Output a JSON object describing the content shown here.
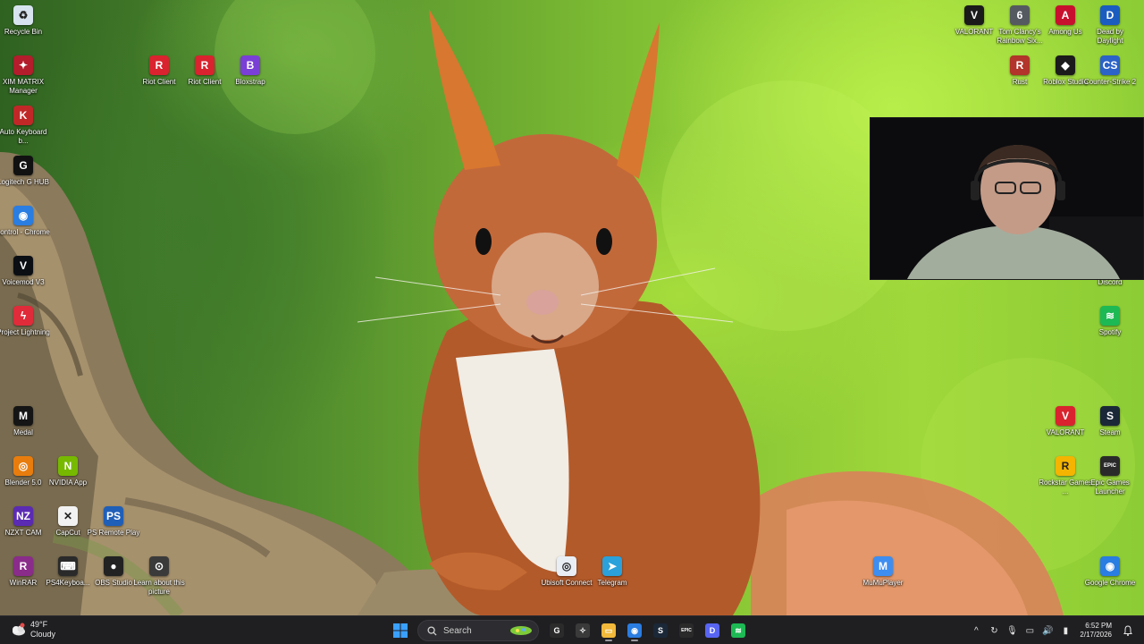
{
  "desktop": {
    "left_icons": [
      {
        "label": "Recycle Bin",
        "icon": "recycle-bin-icon",
        "color": "#d7e4ef",
        "glyph": "♻"
      },
      {
        "label": "XIM MATRIX Manager",
        "icon": "xim-matrix-icon",
        "color": "#b31d2c",
        "glyph": "✦"
      },
      {
        "label": "Auto Keyboard b...",
        "icon": "auto-keyboard-icon",
        "color": "#c02828",
        "glyph": "K"
      },
      {
        "label": "Logitech G HUB",
        "icon": "logitech-ghub-icon",
        "color": "#111111",
        "glyph": "G"
      },
      {
        "label": "control - Chrome",
        "icon": "chrome-icon",
        "color": "#2a7de1",
        "glyph": "◉"
      },
      {
        "label": "Voicemod V3",
        "icon": "voicemod-icon",
        "color": "#0b0f14",
        "glyph": "V"
      },
      {
        "label": "Project Lightning",
        "icon": "project-lightning-icon",
        "color": "#e02b3a",
        "glyph": "ϟ"
      },
      {
        "label": "Medal",
        "icon": "medal-icon",
        "color": "#151515",
        "glyph": "M"
      },
      {
        "label": "Blender 5.0",
        "icon": "blender-icon",
        "color": "#e87d0d",
        "glyph": "◎"
      },
      {
        "label": "NVIDIA App",
        "icon": "nvidia-icon",
        "color": "#76b900",
        "glyph": "N"
      },
      {
        "label": "NZXT CAM",
        "icon": "nzxt-cam-icon",
        "color": "#5b2bb3",
        "glyph": "NZ"
      },
      {
        "label": "CapCut",
        "icon": "capcut-icon",
        "color": "#f2f2f2",
        "glyph": "✕"
      },
      {
        "label": "PS Remote Play",
        "icon": "ps-remote-play-icon",
        "color": "#1f5fb8",
        "glyph": "PS"
      },
      {
        "label": "WinRAR",
        "icon": "winrar-icon",
        "color": "#8a2c8a",
        "glyph": "R"
      },
      {
        "label": "PS4Keyboa...",
        "icon": "ps4-keyboard-icon",
        "color": "#2a2a2a",
        "glyph": "⌨"
      },
      {
        "label": "OBS Studio",
        "icon": "obs-studio-icon",
        "color": "#222222",
        "glyph": "●"
      },
      {
        "label": "Learn about this picture",
        "icon": "learn-picture-icon",
        "color": "#3a3a3a",
        "glyph": "⊙"
      },
      {
        "label": "Riot Client",
        "icon": "riot-client-icon",
        "color": "#d9232e",
        "glyph": "R"
      },
      {
        "label": "Riot Client",
        "icon": "riot-client-icon",
        "color": "#d9232e",
        "glyph": "R"
      },
      {
        "label": "Bloxstrap",
        "icon": "bloxstrap-icon",
        "color": "#7a3fd6",
        "glyph": "B"
      }
    ],
    "right_icons": [
      {
        "label": "VALORANT",
        "icon": "valorant-icon",
        "color": "#1a1a1a",
        "glyph": "V"
      },
      {
        "label": "Tom Clancy's Rainbow Six...",
        "icon": "rainbow-six-icon",
        "color": "#555a60",
        "glyph": "6"
      },
      {
        "label": "Among Us",
        "icon": "among-us-icon",
        "color": "#c8102e",
        "glyph": "A"
      },
      {
        "label": "Dead by Daylight",
        "icon": "dead-by-daylight-icon",
        "color": "#1b5cc0",
        "glyph": "D"
      },
      {
        "label": "Rust",
        "icon": "rust-icon",
        "color": "#b2342a",
        "glyph": "R"
      },
      {
        "label": "Roblox Studio",
        "icon": "roblox-studio-icon",
        "color": "#1b1b1b",
        "glyph": "◆"
      },
      {
        "label": "Counter-Strike 2",
        "icon": "counter-strike-icon",
        "color": "#2b63c7",
        "glyph": "CS"
      },
      {
        "label": "Discord",
        "icon": "discord-icon",
        "color": "#5865f2",
        "glyph": "D"
      },
      {
        "label": "Spotify",
        "icon": "spotify-icon",
        "color": "#1db954",
        "glyph": "≋"
      },
      {
        "label": "VALORANT",
        "icon": "valorant-icon",
        "color": "#d9232e",
        "glyph": "V"
      },
      {
        "label": "Steam",
        "icon": "steam-icon",
        "color": "#1b2838",
        "glyph": "S"
      },
      {
        "label": "Rockstar Games ...",
        "icon": "rockstar-icon",
        "color": "#f4b400",
        "glyph": "R"
      },
      {
        "label": "Epic Games Launcher",
        "icon": "epic-games-icon",
        "color": "#2a2a2a",
        "glyph": "EPIC"
      },
      {
        "label": "MuMuPlayer",
        "icon": "mumuplayer-icon",
        "color": "#3d8ef0",
        "glyph": "M"
      },
      {
        "label": "Google Chrome",
        "icon": "chrome-icon",
        "color": "#2a7de1",
        "glyph": "◉"
      },
      {
        "label": "Ubisoft Connect",
        "icon": "ubisoft-connect-icon",
        "color": "#e9eef5",
        "glyph": "◎"
      },
      {
        "label": "Telegram",
        "icon": "telegram-icon",
        "color": "#2aa1da",
        "glyph": "➤"
      }
    ]
  },
  "taskbar": {
    "weather": {
      "temp": "49°F",
      "condition": "Cloudy",
      "icon": "weather-cloudy-icon"
    },
    "search_placeholder": "Search",
    "pinned": [
      {
        "name": "start-icon",
        "color": "#3aa0ff",
        "glyph": "⊞"
      },
      {
        "name": "g-app-icon",
        "color": "#2b2b2b",
        "glyph": "G"
      },
      {
        "name": "settings-app-icon",
        "color": "#3a3a3a",
        "glyph": "✧"
      },
      {
        "name": "file-explorer-icon",
        "color": "#f2b93b",
        "glyph": "▭"
      },
      {
        "name": "chrome-icon",
        "color": "#2a7de1",
        "glyph": "◉"
      },
      {
        "name": "steam-icon",
        "color": "#1b2838",
        "glyph": "S"
      },
      {
        "name": "epic-games-icon",
        "color": "#2a2a2a",
        "glyph": "EPIC"
      },
      {
        "name": "discord-icon",
        "color": "#5865f2",
        "glyph": "D"
      },
      {
        "name": "spotify-icon",
        "color": "#1db954",
        "glyph": "≋"
      }
    ],
    "tray": [
      {
        "name": "tray-overflow-chevron-icon",
        "glyph": "^"
      },
      {
        "name": "sync-icon",
        "glyph": "↻"
      },
      {
        "name": "microphone-icon",
        "glyph": "🎙"
      },
      {
        "name": "network-icon",
        "glyph": "▭"
      },
      {
        "name": "volume-icon",
        "glyph": "🔊"
      },
      {
        "name": "battery-icon",
        "glyph": "▮"
      }
    ],
    "time": "6:52 PM",
    "date": "2/17/2026",
    "notification_icon": "bell-icon"
  },
  "webcam_overlay": {
    "icon": "webcam-feed"
  }
}
